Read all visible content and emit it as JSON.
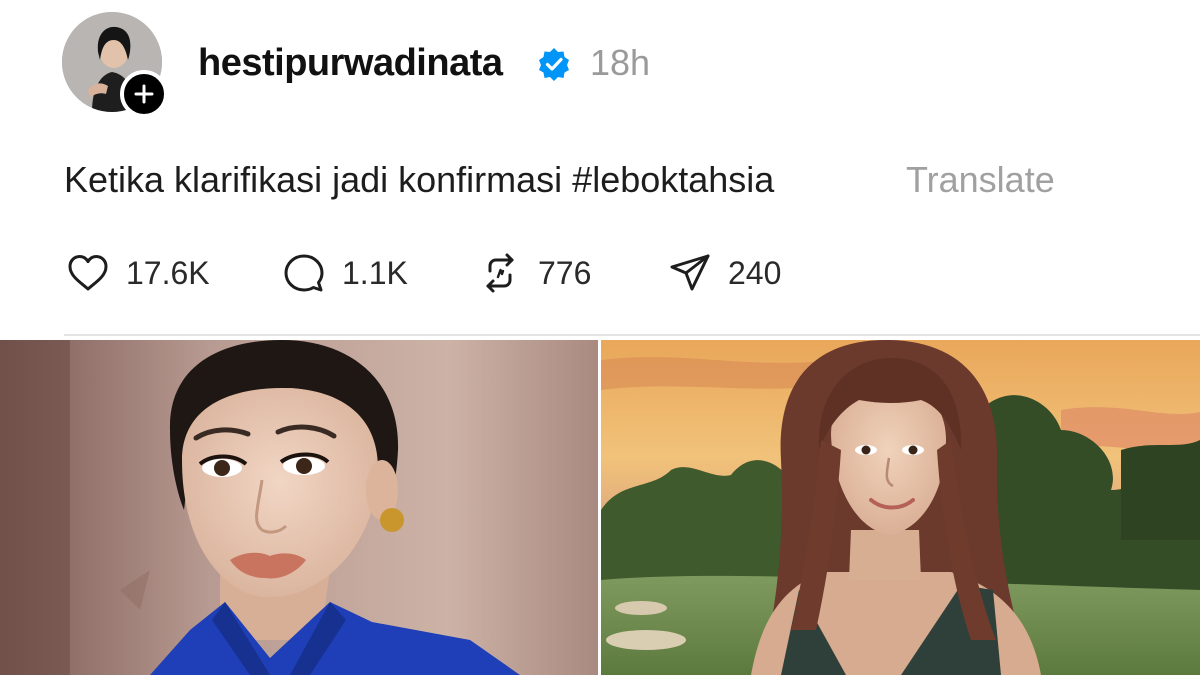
{
  "post": {
    "username": "hestipurwadinata",
    "verified": true,
    "timestamp": "18h",
    "caption_text": "Ketika klarifikasi jadi konfirmasi ",
    "hashtag": "#leboktahsia",
    "translate_label": "Translate"
  },
  "actions": {
    "likes": "17.6K",
    "comments": "1.1K",
    "reposts": "776",
    "shares": "240"
  },
  "icons": {
    "follow": "plus-icon",
    "verified": "verified-badge-icon",
    "like": "heart-icon",
    "comment": "comment-bubble-icon",
    "repost": "repost-icon",
    "share": "send-icon"
  },
  "colors": {
    "verified_blue": "#0095f6",
    "secondary_text": "#9a9a9a",
    "divider": "#e4e4e4"
  }
}
